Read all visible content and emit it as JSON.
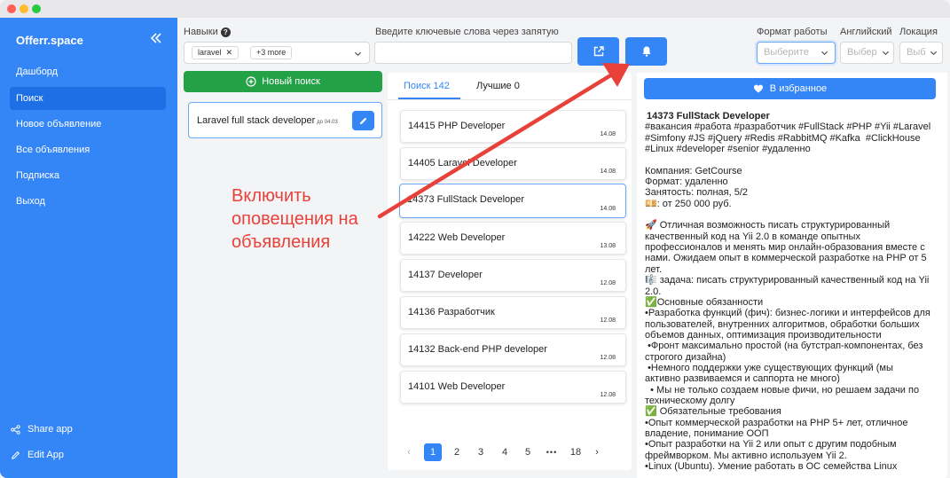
{
  "window": {
    "traffic_lights": [
      "#fe5f57",
      "#febc2e",
      "#28c840"
    ]
  },
  "sidebar": {
    "brand": "Offerr.space",
    "collapse_icon": "double-chevron-left-icon",
    "items": [
      {
        "label": "Дашборд",
        "active": false
      },
      {
        "label": "Поиск",
        "active": true
      },
      {
        "label": "Новое объявление",
        "active": false
      },
      {
        "label": "Все объявления",
        "active": false
      },
      {
        "label": "Подписка",
        "active": false
      },
      {
        "label": "Выход",
        "active": false
      }
    ],
    "bottom": [
      {
        "label": "Share app",
        "icon": "share-icon"
      },
      {
        "label": "Edit App",
        "icon": "pencil-icon"
      }
    ],
    "accent": "#3485f6"
  },
  "filters": {
    "skills_label": "Навыки",
    "skills_chips": [
      "laravel",
      "+3 more"
    ],
    "keywords_label": "Введите ключевые слова через запятую",
    "keywords_value": "",
    "work_format_label": "Формат работы",
    "work_format_placeholder": "Выберите",
    "english_label": "Английский",
    "english_placeholder": "Выбер",
    "location_label": "Локация",
    "location_placeholder": "Выб"
  },
  "actions": {
    "external_link_icon": "external-link-icon",
    "notify_icon": "bell-icon",
    "new_search_label": "Новый поиск",
    "new_search_color": "#22a147"
  },
  "saved_search": {
    "title": "Laravel full stack developer",
    "date": "до 04.03"
  },
  "tabs": [
    {
      "label": "Поиск 142",
      "active": true
    },
    {
      "label": "Лучшие 0",
      "active": false
    }
  ],
  "jobs": [
    {
      "title": "14415 PHP Developer",
      "date": "14.08",
      "selected": false
    },
    {
      "title": "14405 Laravel Developer",
      "date": "14.08",
      "selected": false
    },
    {
      "title": "14373 FullStack Developer",
      "date": "14.08",
      "selected": true
    },
    {
      "title": "14222 Web Developer",
      "date": "13.08",
      "selected": false
    },
    {
      "title": "14137 Developer",
      "date": "12.08",
      "selected": false
    },
    {
      "title": "14136 Разработчик",
      "date": "12.08",
      "selected": false
    },
    {
      "title": "14132 Back-end PHP developer",
      "date": "12.08",
      "selected": false
    },
    {
      "title": "14101 Web Developer",
      "date": "12.08",
      "selected": false
    }
  ],
  "pagination": {
    "prev": "‹",
    "pages": [
      "1",
      "2",
      "3",
      "4",
      "5"
    ],
    "ellipsis": "•••",
    "last": "18",
    "next": "›",
    "current": "1"
  },
  "detail": {
    "favorite_label": "В избранное",
    "title": "14373 FullStack Developer",
    "body": "#вакансия #работа #разработчик #FullStack #PHP #Yii #Laravel\n#Simfony #JS #jQuery #Redis #RabbitMQ #Kafka  #ClickHouse\n#Linux #developer #senior #удаленно\n\nКомпания: GetCourse\nФормат: удаленно\nЗанятость: полная, 5/2\n💴: от 250 000 руб.\n\n🚀 Отличная возможность писать структурированный\nкачественный код на Yii 2.0 в команде опытных\nпрофессионалов и менять мир онлайн-образования вместе с\nнами. Ожидаем опыт в коммерческой разработке на PHP от 5\nлет.\n🎼 задача: писать структурированный качественный код на Yii\n2.0.\n✅Основные обязанности\n•Разработка функций (фич): бизнес-логики и интерфейсов для\nпользователей, внутренних алгоритмов, обработки больших\nобъемов данных, оптимизация производительности\n •Фронт максимально простой (на бутстрап-компонентах, без\nстрогого дизайна)\n •Немного поддержки уже существующих функций (мы\nактивно развиваемся и саппорта не много)\n  • Мы не только создаем новые фичи, но решаем задачи по\nтехническому долгу\n✅ Обязательные требования\n•Опыт коммерческой разработки на PHP 5+ лет, отличное\nвладение, понимание ООП\n•Опыт разработки на Yii 2 или опыт с другим подобным\nфреймворком. Мы активно используем Yii 2.\n•Linux (Ubuntu). Умение работать в ОС семейства Linux"
  },
  "annotation": {
    "text": "Включить\nоповещения на\nобъявления",
    "color": "#e8413a"
  }
}
